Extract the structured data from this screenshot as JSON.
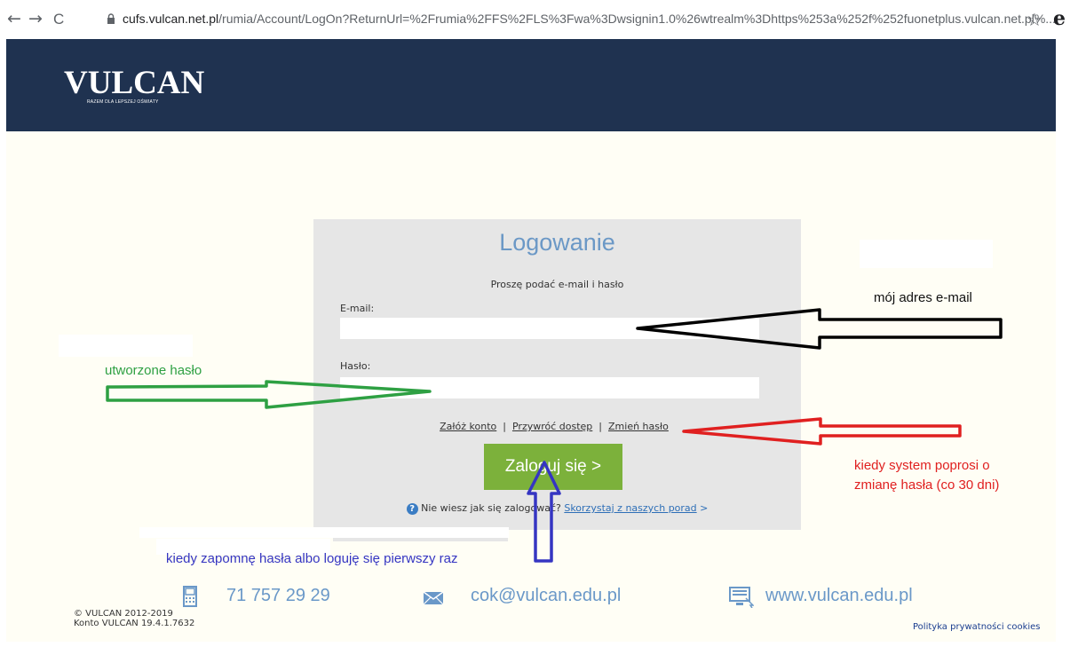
{
  "browser": {
    "back": "←",
    "forward": "→",
    "reload": "C",
    "url_host": "cufs.vulcan.net.pl",
    "url_rest": "/rumia/Account/LogOn?ReturnUrl=%2Frumia%2FFS%2FLS%3Fwa%3Dwsignin1.0%26wtrealm%3Dhttps%253a%252f%252fuonetplus.vulcan.net.pl%...",
    "star": "☆",
    "extension": "e"
  },
  "header": {
    "logo": "VULCAN",
    "tagline": "RAZEM DLA LEPSZEJ OŚWIATY"
  },
  "login": {
    "title": "Logowanie",
    "subtitle": "Proszę podać e-mail i hasło",
    "email_label": "E-mail:",
    "email_value": "",
    "password_label": "Hasło:",
    "password_value": "",
    "link_create": "Załóż konto",
    "link_restore": "Przywróć dostęp",
    "link_change": "Zmień hasło",
    "separator": "|",
    "button": "Zaloguj się >",
    "help_text": "Nie wiesz jak się zalogować?",
    "help_link": "Skorzystaj z naszych porad",
    "help_arrow": ">"
  },
  "footer": {
    "phone": "71 757 29 29",
    "email": "cok@vulcan.edu.pl",
    "website": "www.vulcan.edu.pl",
    "copyright_line1": "© VULCAN 2012-2019",
    "copyright_line2": "Konto VULCAN 19.4.1.7632",
    "privacy": "Polityka prywatności cookies"
  },
  "annotations": {
    "email_note": "mój adres e-mail",
    "password_note": "utworzone hasło",
    "change_note_line1": "kiedy system poprosi o",
    "change_note_line2": "zmianę hasła (co 30 dni)",
    "forgot_note": "kiedy zapomnę hasła albo loguję się pierwszy raz",
    "colors": {
      "email_arrow": "#000000",
      "password_arrow": "#2ea043",
      "change_arrow": "#e02020",
      "forgot_arrow": "#3535c2"
    }
  },
  "colors": {
    "header_bg": "#1f3250",
    "button_bg": "#7cb13b",
    "title": "#6b98c6"
  }
}
